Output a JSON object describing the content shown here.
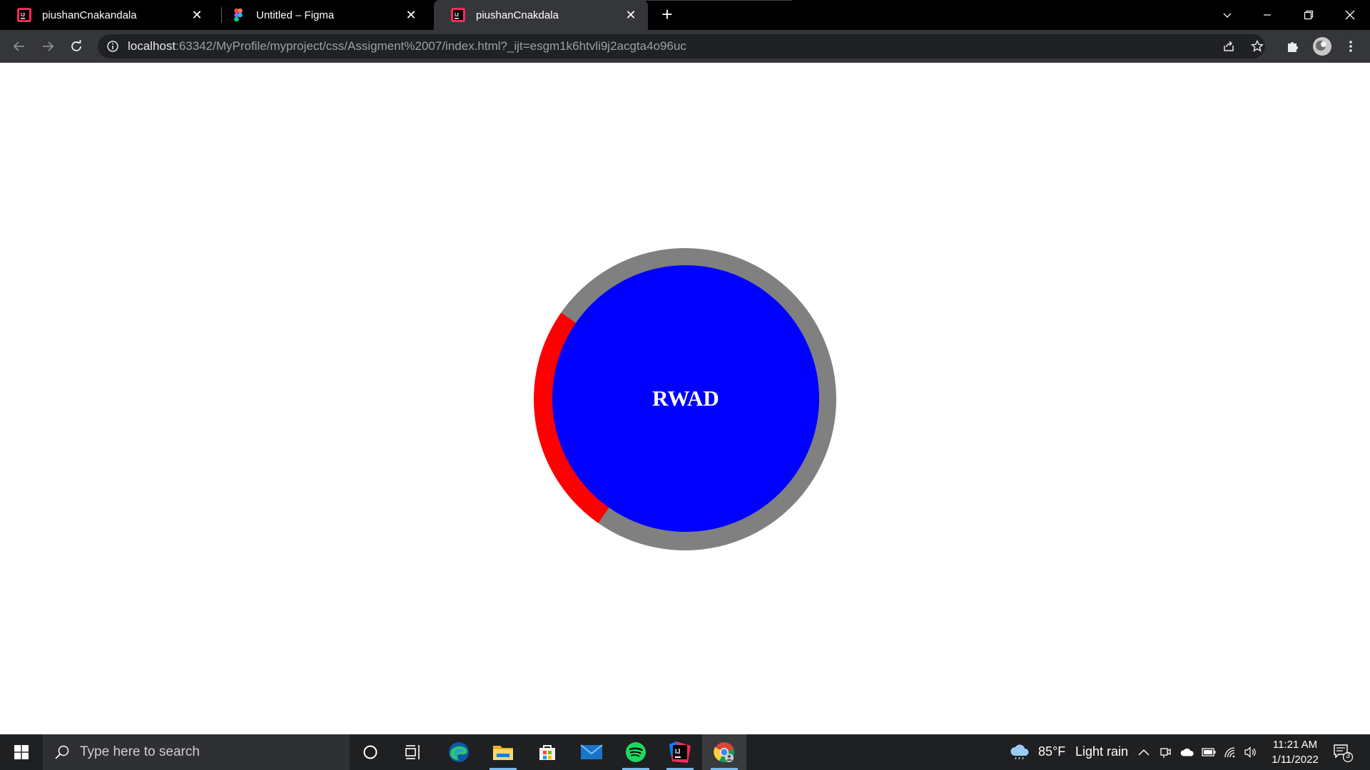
{
  "browser": {
    "tabs": [
      {
        "title": "piushanCnakandala",
        "icon": "intellij-icon",
        "active": false
      },
      {
        "title": "Untitled – Figma",
        "icon": "figma-icon",
        "active": false
      },
      {
        "title": "piushanCnakdala",
        "icon": "intellij-icon",
        "active": true
      }
    ],
    "tab_close_glyph": "✕",
    "new_tab_glyph": "+",
    "url_host": "localhost",
    "url_rest": ":63342/MyProfile/myproject/css/Assigment%2007/index.html?_ijt=esgm1k6htvli9j2acgta4o96uc"
  },
  "page": {
    "circle_label": "RWAD",
    "colors": {
      "ring": "#808080",
      "ring_accent": "#ff0000",
      "disc": "#0000ff",
      "label": "#ffffff"
    }
  },
  "taskbar": {
    "search_placeholder": "Type here to search",
    "weather_temp": "85°F",
    "weather_desc": "Light rain",
    "time": "11:21 AM",
    "date": "1/11/2022",
    "notification_count": "3"
  }
}
